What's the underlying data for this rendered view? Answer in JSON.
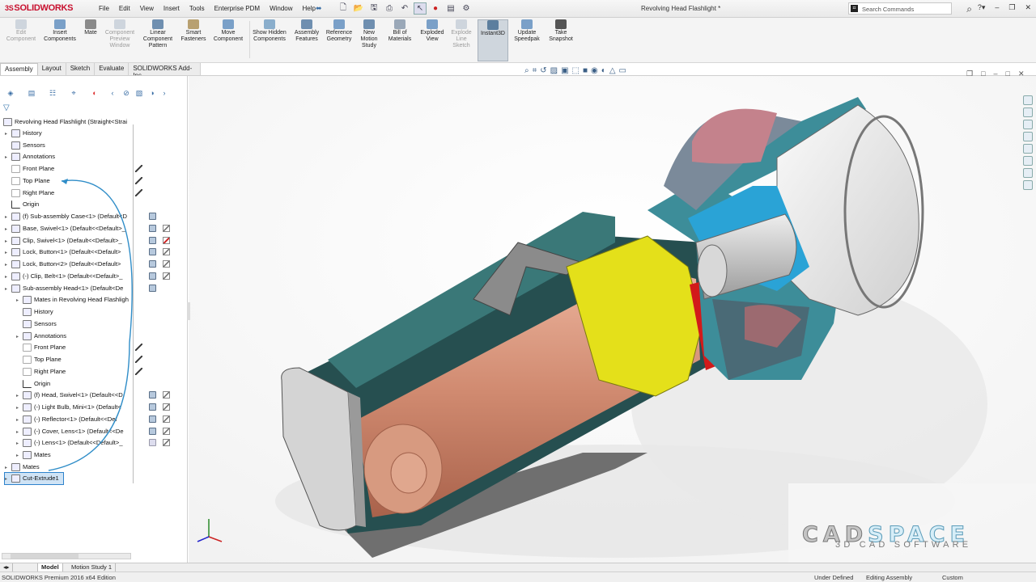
{
  "app": {
    "logo": "SOLIDWORKS",
    "doc_title": "Revolving Head Flashlight *",
    "menu": [
      "File",
      "Edit",
      "View",
      "Insert",
      "Tools",
      "Enterprise PDM",
      "Window",
      "Help"
    ],
    "search_placeholder": "Search Commands"
  },
  "ribbon": {
    "buttons": [
      {
        "label": "Edit Component",
        "state": "disabled"
      },
      {
        "label": "Insert Components",
        "state": "normal"
      },
      {
        "label": "Mate",
        "state": "normal"
      },
      {
        "label": "Component Preview Window",
        "state": "disabled"
      },
      {
        "label": "Linear Component Pattern",
        "state": "normal"
      },
      {
        "label": "Smart Fasteners",
        "state": "normal"
      },
      {
        "label": "Move Component",
        "state": "normal"
      },
      {
        "label": "Show Hidden Components",
        "state": "normal"
      },
      {
        "label": "Assembly Features",
        "state": "normal"
      },
      {
        "label": "Reference Geometry",
        "state": "normal"
      },
      {
        "label": "New Motion Study",
        "state": "normal"
      },
      {
        "label": "Bill of Materials",
        "state": "normal"
      },
      {
        "label": "Exploded View",
        "state": "normal"
      },
      {
        "label": "Explode Line Sketch",
        "state": "disabled"
      },
      {
        "label": "Instant3D",
        "state": "active"
      },
      {
        "label": "Update Speedpak",
        "state": "normal"
      },
      {
        "label": "Take Snapshot",
        "state": "normal"
      }
    ]
  },
  "tabs": [
    "Assembly",
    "Layout",
    "Sketch",
    "Evaluate",
    "SOLIDWORKS Add-Ins"
  ],
  "tree": {
    "root": "Revolving Head Flashlight  (Straight<Strai",
    "items": [
      {
        "label": "History",
        "icon": "history-icon"
      },
      {
        "label": "Sensors",
        "icon": "sensor-icon"
      },
      {
        "label": "Annotations",
        "icon": "annotation-icon"
      },
      {
        "label": "Front Plane",
        "icon": "plane-icon"
      },
      {
        "label": "Top Plane",
        "icon": "plane-icon"
      },
      {
        "label": "Right Plane",
        "icon": "plane-icon"
      },
      {
        "label": "Origin",
        "icon": "origin-icon"
      },
      {
        "label": "(f) Sub-assembly Case<1> (Default<D",
        "icon": "subassembly-icon"
      },
      {
        "label": "Base, Swivel<1> (Default<<Default>_",
        "icon": "part-icon"
      },
      {
        "label": "Clip, Swivel<1> (Default<<Default>_",
        "icon": "part-icon"
      },
      {
        "label": "Lock, Button<1> (Default<<Default>",
        "icon": "part-icon"
      },
      {
        "label": "Lock, Button<2> (Default<<Default>",
        "icon": "part-icon"
      },
      {
        "label": "(-) Clip, Belt<1> (Default<<Default>_",
        "icon": "part-icon"
      },
      {
        "label": "Sub-assembly Head<1> (Default<De",
        "icon": "subassembly-icon"
      },
      {
        "label": "Mates in Revolving Head Flashligh",
        "icon": "mates-icon"
      },
      {
        "label": "History",
        "icon": "history-icon"
      },
      {
        "label": "Sensors",
        "icon": "sensor-icon"
      },
      {
        "label": "Annotations",
        "icon": "annotation-icon"
      },
      {
        "label": "Front Plane",
        "icon": "plane-icon"
      },
      {
        "label": "Top Plane",
        "icon": "plane-icon"
      },
      {
        "label": "Right Plane",
        "icon": "plane-icon"
      },
      {
        "label": "Origin",
        "icon": "origin-icon"
      },
      {
        "label": "(f) Head, Swivel<1> (Default<<D",
        "icon": "part-icon"
      },
      {
        "label": "(-) Light Bulb, Mini<1> (Default<",
        "icon": "part-icon"
      },
      {
        "label": "(-) Reflector<1> (Default<<Def",
        "icon": "part-icon"
      },
      {
        "label": "(-) Cover, Lens<1> (Default<<De",
        "icon": "part-icon"
      },
      {
        "label": "(-) Lens<1> (Default<<Default>_",
        "icon": "part-icon"
      },
      {
        "label": "Mates",
        "icon": "mates-icon"
      },
      {
        "label": "Mates",
        "icon": "mates-icon"
      },
      {
        "label": "Cut-Extrude1",
        "icon": "cut-extrude-icon"
      }
    ]
  },
  "bottom_tabs": [
    "Model",
    "Motion Study 1"
  ],
  "status": {
    "edition": "SOLIDWORKS Premium 2016 x64 Edition",
    "defined": "Under Defined",
    "mode": "Editing Assembly",
    "units": "Custom"
  },
  "watermark": {
    "cad": "CAD",
    "space": "SPACE",
    "tagline": "3D CAD SOFTWARE"
  },
  "colors": {
    "brand_red": "#c8102e",
    "battery": "#d9957a",
    "body_teal": "#2e6f6f",
    "collar_yellow": "#e8e31e",
    "reflector_blue": "#2a9fd6",
    "selection_blue": "#2f83cc"
  }
}
